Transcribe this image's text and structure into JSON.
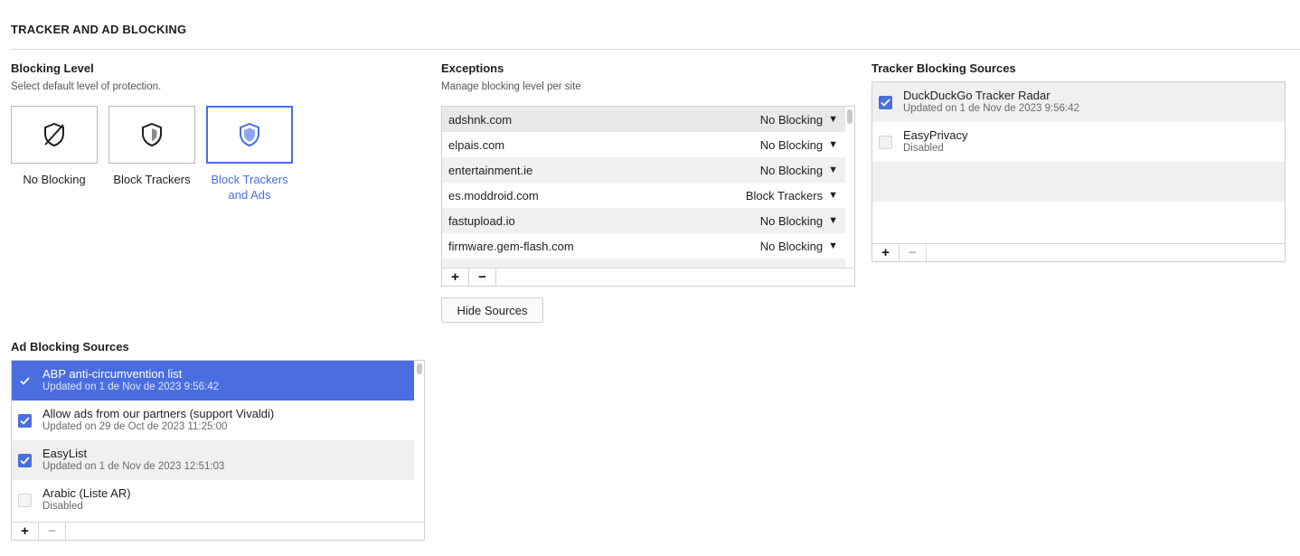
{
  "section": {
    "title": "TRACKER AND AD BLOCKING"
  },
  "blocking_level": {
    "heading": "Blocking Level",
    "description": "Select default level of protection.",
    "options": [
      {
        "label": "No Blocking",
        "icon": "shield-off-icon",
        "selected": false
      },
      {
        "label": "Block Trackers",
        "icon": "shield-half-icon",
        "selected": false
      },
      {
        "label": "Block Trackers and Ads",
        "label_line1": "Block Trackers",
        "label_line2": "and Ads",
        "icon": "shield-full-icon",
        "selected": true
      }
    ]
  },
  "exceptions": {
    "heading": "Exceptions",
    "description": "Manage blocking level per site",
    "rows": [
      {
        "site": "adshnk.com",
        "level": "No Blocking"
      },
      {
        "site": "elpais.com",
        "level": "No Blocking"
      },
      {
        "site": "entertainment.ie",
        "level": "No Blocking"
      },
      {
        "site": "es.moddroid.com",
        "level": "Block Trackers"
      },
      {
        "site": "fastupload.io",
        "level": "No Blocking"
      },
      {
        "site": "firmware.gem-flash.com",
        "level": "No Blocking"
      }
    ],
    "add_label": "+",
    "remove_label": "−",
    "hide_sources_label": "Hide Sources"
  },
  "tracker_sources": {
    "heading": "Tracker Blocking Sources",
    "items": [
      {
        "name": "DuckDuckGo Tracker Radar",
        "meta": "Updated on 1 de Nov de 2023 9:56:42",
        "checked": true
      },
      {
        "name": "EasyPrivacy",
        "meta": "Disabled",
        "checked": false
      }
    ],
    "add_label": "+",
    "remove_label": "−"
  },
  "ad_sources": {
    "heading": "Ad Blocking Sources",
    "items": [
      {
        "name": "ABP anti-circumvention list",
        "meta": "Updated on 1 de Nov de 2023 9:56:42",
        "checked": true
      },
      {
        "name": "Allow ads from our partners (support Vivaldi)",
        "meta": "Updated on 29 de Oct de 2023 11:25:00",
        "checked": true
      },
      {
        "name": "EasyList",
        "meta": "Updated on 1 de Nov de 2023 12:51:03",
        "checked": true
      },
      {
        "name": "Arabic (Liste AR)",
        "meta": "Disabled",
        "checked": false
      }
    ],
    "add_label": "+",
    "remove_label": "−"
  },
  "colors": {
    "accent": "#4a6ee0",
    "row_alt": "#f0f0f0",
    "border": "#cfcfcf"
  }
}
